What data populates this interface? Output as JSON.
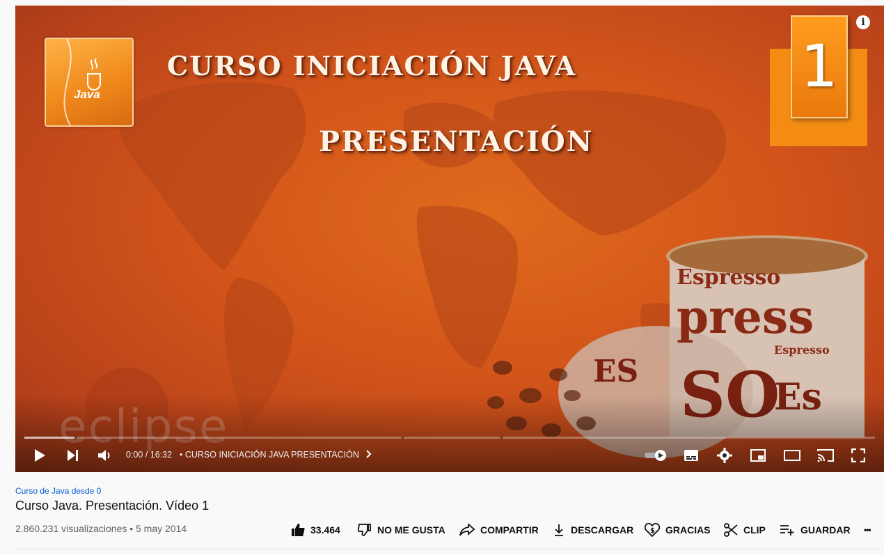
{
  "player": {
    "slide_title_line1": "CURSO INICIACIÓN JAVA",
    "slide_title_line2": "PRESENTACIÓN",
    "episode_number": "1",
    "java_logo_text": "Java",
    "watermark": "eclipse",
    "info_icon": "i",
    "progress_loaded_fraction": 0.06,
    "time": "0:00 / 16:32",
    "chapter_label": "• CURSO INICIACIÓN JAVA PRESENTACIÓN",
    "icons": [
      "play-icon",
      "next-icon",
      "volume-icon",
      "chevron-right-icon",
      "autoplay-toggle-icon",
      "subtitles-icon",
      "settings-gear-icon",
      "miniplayer-icon",
      "theater-icon",
      "cast-icon",
      "fullscreen-icon"
    ]
  },
  "video": {
    "playlist": "Curso de Java desde 0",
    "title": "Curso Java. Presentación. Vídeo 1",
    "views_date": "2.860.231 visualizaciones • 5 may 2014"
  },
  "actions": {
    "likes": "33.464",
    "dislike": "NO ME GUSTA",
    "share": "COMPARTIR",
    "download": "DESCARGAR",
    "thanks": "GRACIAS",
    "clip": "CLIP",
    "save": "GUARDAR",
    "more": "•••"
  },
  "colors": {
    "accent_link": "#065fd4",
    "slide_orange": "#d2541a"
  }
}
